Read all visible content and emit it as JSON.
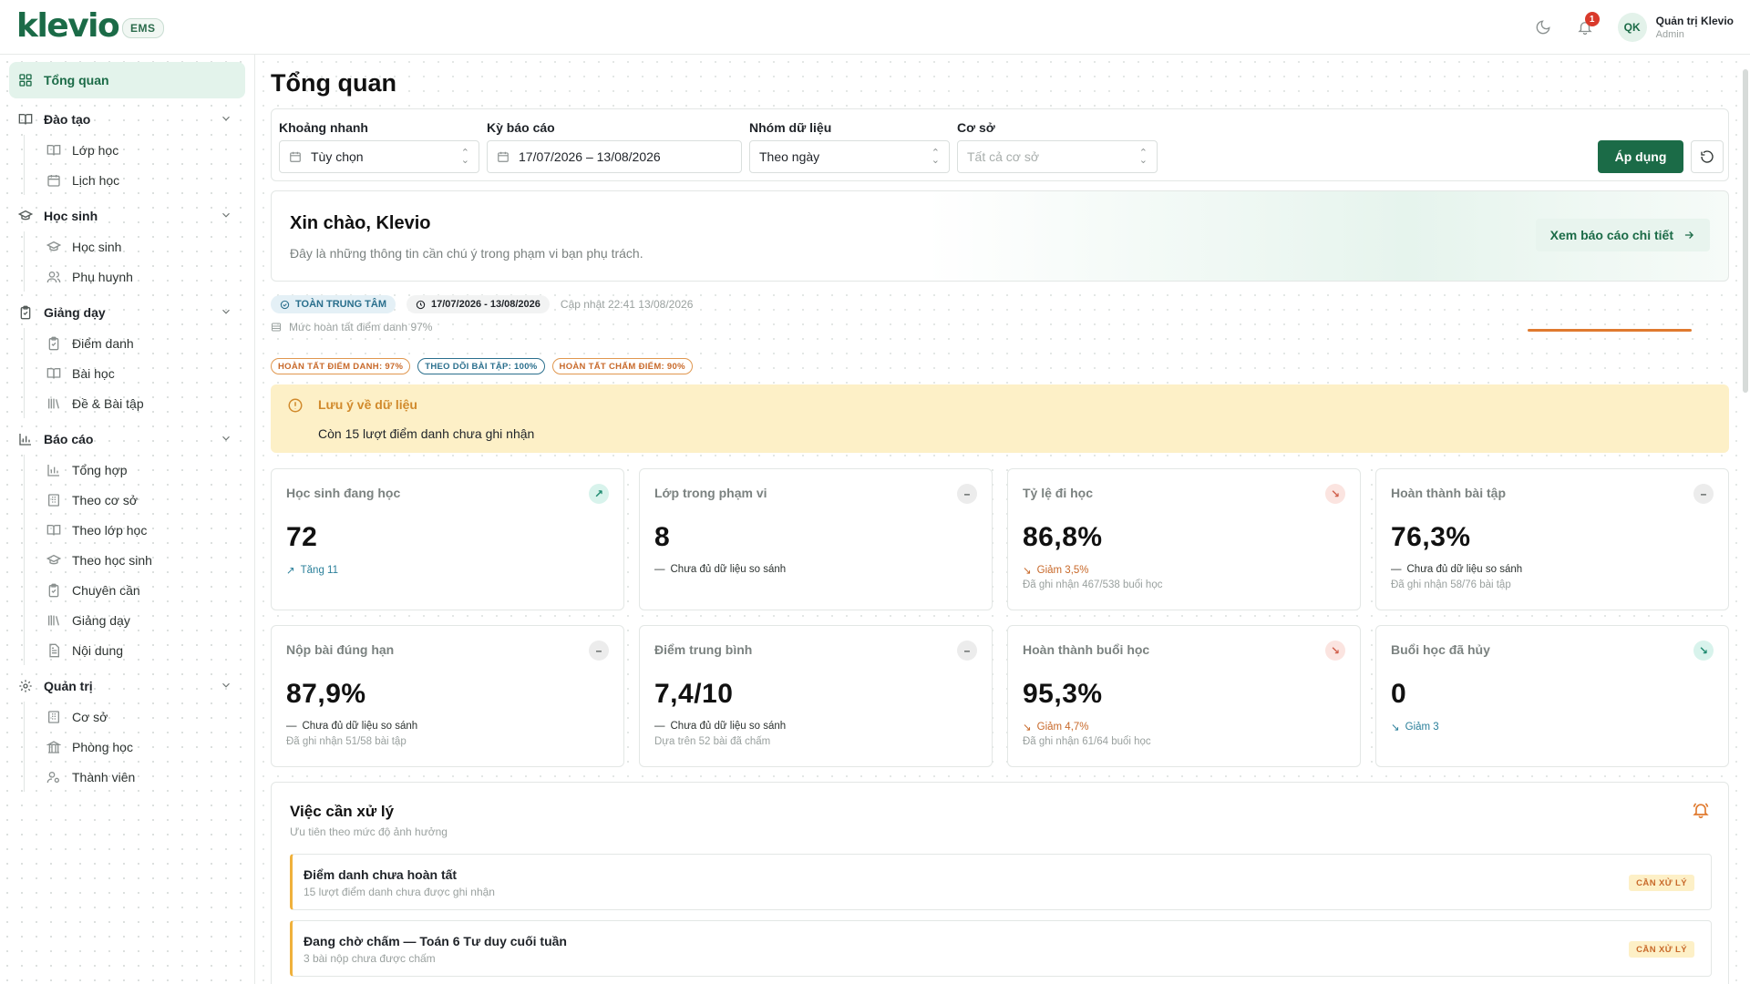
{
  "brand": {
    "logo": "klevio",
    "badge": "EMS"
  },
  "user": {
    "initials": "QK",
    "name": "Quản trị Klevio",
    "role": "Admin"
  },
  "notifications": {
    "count": "1"
  },
  "sidebar": {
    "active": {
      "label": "Tổng quan",
      "icon": "dashboard-icon"
    },
    "groups": [
      {
        "label": "Đào tạo",
        "icon": "book-icon",
        "items": [
          {
            "label": "Lớp học",
            "icon": "book-open-icon"
          },
          {
            "label": "Lịch học",
            "icon": "calendar-icon"
          }
        ]
      },
      {
        "label": "Học sinh",
        "icon": "graduation-cap-icon",
        "items": [
          {
            "label": "Học sinh",
            "icon": "graduation-cap-icon"
          },
          {
            "label": "Phụ huynh",
            "icon": "users-icon"
          }
        ]
      },
      {
        "label": "Giảng dạy",
        "icon": "clipboard-icon",
        "items": [
          {
            "label": "Điểm danh",
            "icon": "clipboard-check-icon"
          },
          {
            "label": "Bài học",
            "icon": "book-open-icon"
          },
          {
            "label": "Đề & Bài tập",
            "icon": "library-icon"
          }
        ]
      },
      {
        "label": "Báo cáo",
        "icon": "bar-chart-icon",
        "items": [
          {
            "label": "Tổng hợp",
            "icon": "bar-chart-icon"
          },
          {
            "label": "Theo cơ sở",
            "icon": "building-icon"
          },
          {
            "label": "Theo lớp học",
            "icon": "book-open-icon"
          },
          {
            "label": "Theo học sinh",
            "icon": "graduation-cap-icon"
          },
          {
            "label": "Chuyên cần",
            "icon": "clipboard-check-icon"
          },
          {
            "label": "Giảng dạy",
            "icon": "library-icon"
          },
          {
            "label": "Nội dung",
            "icon": "file-text-icon"
          }
        ]
      },
      {
        "label": "Quản trị",
        "icon": "gear-icon",
        "items": [
          {
            "label": "Cơ sở",
            "icon": "building-icon"
          },
          {
            "label": "Phòng học",
            "icon": "columns-icon"
          },
          {
            "label": "Thành viên",
            "icon": "user-key-icon"
          }
        ]
      }
    ]
  },
  "page": {
    "title": "Tổng quan"
  },
  "filters": {
    "quick": {
      "label": "Khoảng nhanh",
      "value": "Tùy chọn"
    },
    "period": {
      "label": "Kỳ báo cáo",
      "value": "17/07/2026 – 13/08/2026"
    },
    "group": {
      "label": "Nhóm dữ liệu",
      "value": "Theo ngày"
    },
    "site": {
      "label": "Cơ sở",
      "placeholder": "Tất cả cơ sở"
    },
    "apply": "Áp dụng"
  },
  "welcome": {
    "title": "Xin chào, Klevio",
    "subtitle": "Đây là những thông tin cần chú ý trong phạm vi bạn phụ trách.",
    "link": "Xem báo cáo chi tiết"
  },
  "meta": {
    "scope": "TOÀN TRUNG TÂM",
    "range": "17/07/2026 - 13/08/2026",
    "updated": "Cập nhật 22:41 13/08/2026",
    "attendance": "Mức hoàn tất điểm danh 97%"
  },
  "tags": [
    {
      "label": "HOÀN TẤT ĐIỂM DANH: 97%",
      "tone": "orange"
    },
    {
      "label": "THEO DÕI BÀI TẬP: 100%",
      "tone": "teal"
    },
    {
      "label": "HOÀN TẤT CHẤM ĐIỂM: 90%",
      "tone": "orange"
    }
  ],
  "alert": {
    "title": "Lưu ý về dữ liệu",
    "body": "Còn 15 lượt điểm danh chưa ghi nhận"
  },
  "kpis": [
    {
      "label": "Học sinh đang học",
      "value": "72",
      "trend": "up",
      "delta": "Tăng 11",
      "delta_tone": "teal",
      "delta_icon": "↗",
      "note": ""
    },
    {
      "label": "Lớp trong phạm vi",
      "value": "8",
      "trend": "flat",
      "delta": "Chưa đủ dữ liệu so sánh",
      "delta_tone": "gray",
      "delta_icon": "—",
      "note": ""
    },
    {
      "label": "Tỷ lệ đi học",
      "value": "86,8%",
      "trend": "down",
      "delta": "Giảm 3,5%",
      "delta_tone": "orange",
      "delta_icon": "↘",
      "note": "Đã ghi nhận 467/538 buổi học"
    },
    {
      "label": "Hoàn thành bài tập",
      "value": "76,3%",
      "trend": "flat",
      "delta": "Chưa đủ dữ liệu so sánh",
      "delta_tone": "gray",
      "delta_icon": "—",
      "note": "Đã ghi nhận 58/76 bài tập"
    },
    {
      "label": "Nộp bài đúng hạn",
      "value": "87,9%",
      "trend": "flat",
      "delta": "Chưa đủ dữ liệu so sánh",
      "delta_tone": "gray",
      "delta_icon": "—",
      "note": "Đã ghi nhận 51/58 bài tập"
    },
    {
      "label": "Điểm trung bình",
      "value": "7,4/10",
      "trend": "flat",
      "delta": "Chưa đủ dữ liệu so sánh",
      "delta_tone": "gray",
      "delta_icon": "—",
      "note": "Dựa trên 52 bài đã chấm"
    },
    {
      "label": "Hoàn thành buổi học",
      "value": "95,3%",
      "trend": "down",
      "delta": "Giảm 4,7%",
      "delta_tone": "orange",
      "delta_icon": "↘",
      "note": "Đã ghi nhận 61/64 buổi học"
    },
    {
      "label": "Buổi học đã hủy",
      "value": "0",
      "trend": "downgood",
      "delta": "Giảm 3",
      "delta_tone": "teal",
      "delta_icon": "↘",
      "note": ""
    }
  ],
  "tasks": {
    "title": "Việc cần xử lý",
    "subtitle": "Ưu tiên theo mức độ ảnh hưởng",
    "items": [
      {
        "title": "Điểm danh chưa hoàn tất",
        "desc": "15 lượt điểm danh chưa được ghi nhận",
        "badge": "CẦN XỬ LÝ"
      },
      {
        "title": "Đang chờ chấm — Toán 6 Tư duy cuối tuần",
        "desc": "3 bài nộp chưa được chấm",
        "badge": "CẦN XỬ LÝ"
      }
    ]
  },
  "colors": {
    "brand": "#1b6b47",
    "accent_orange": "#e07a2f",
    "alert_bg": "#fdf0c7",
    "teal": "#2a6f8d"
  }
}
